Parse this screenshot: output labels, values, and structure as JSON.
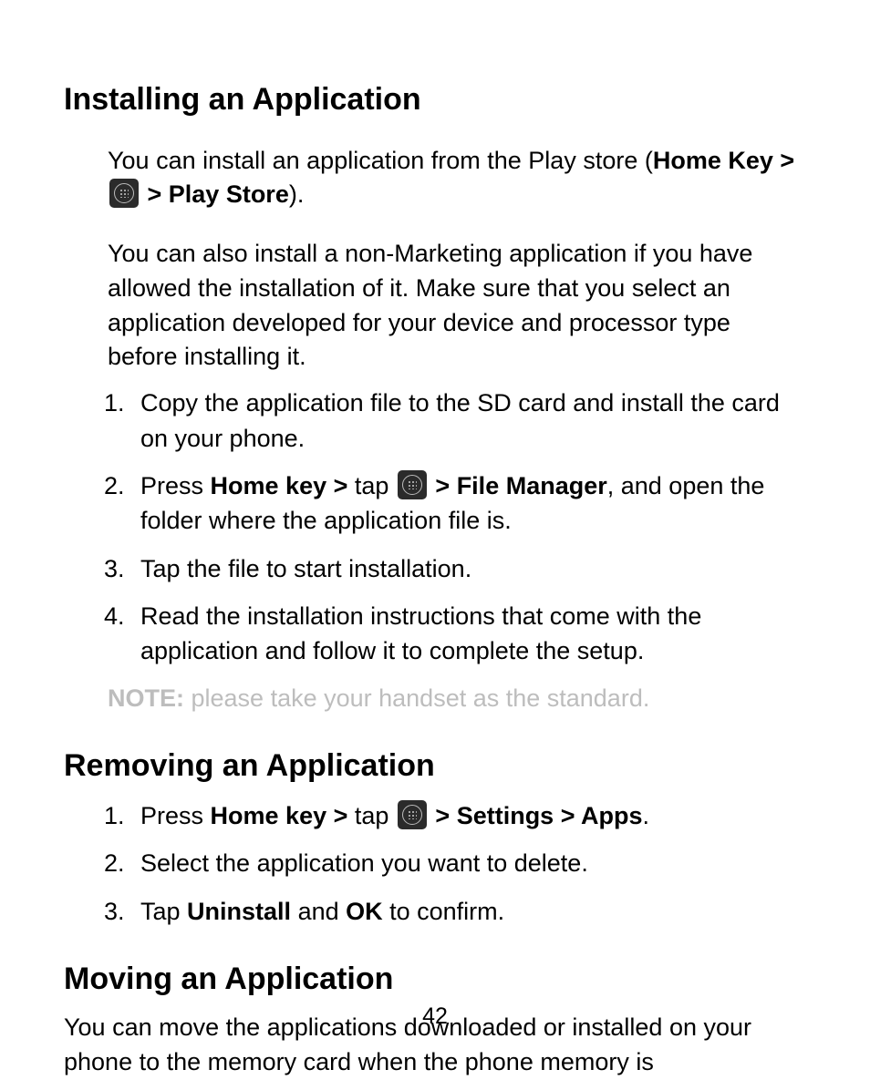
{
  "pageNumber": "42",
  "section1": {
    "title": "Installing an Application",
    "intro1": {
      "pre": "You can install an application from the Play store (",
      "bold1": "Home Key > ",
      "bold2": " > Play Store",
      "post": ")."
    },
    "intro2": "You can also install a non-Marketing application if you have allowed the installation of it. Make sure that you select an application developed for your device and processor type before installing it.",
    "steps": {
      "s1": "Copy the application file to the SD card and install the card on your phone.",
      "s2": {
        "pre": "Press ",
        "bold1": "Home key > ",
        "mid": "tap ",
        "bold2": " > File Manager",
        "post": ", and open the folder where the application file is."
      },
      "s3": "Tap the file to start installation.",
      "s4": "Read the installation instructions that come with the application and follow it to complete the setup."
    },
    "note": {
      "label": "NOTE:",
      "text": " please take your handset as the standard."
    }
  },
  "section2": {
    "title": "Removing an Application",
    "steps": {
      "s1": {
        "pre": "Press ",
        "bold1": "Home key > ",
        "mid": "tap ",
        "bold2": " > Settings > Apps",
        "post": "."
      },
      "s2": "Select the application you want to delete.",
      "s3": {
        "pre": "Tap ",
        "bold1": "Uninstall",
        "mid": " and ",
        "bold2": "OK",
        "post": " to confirm."
      }
    }
  },
  "section3": {
    "title": "Moving an Application",
    "body": "You can move the applications downloaded or installed on your phone to the memory card when the phone memory is"
  }
}
